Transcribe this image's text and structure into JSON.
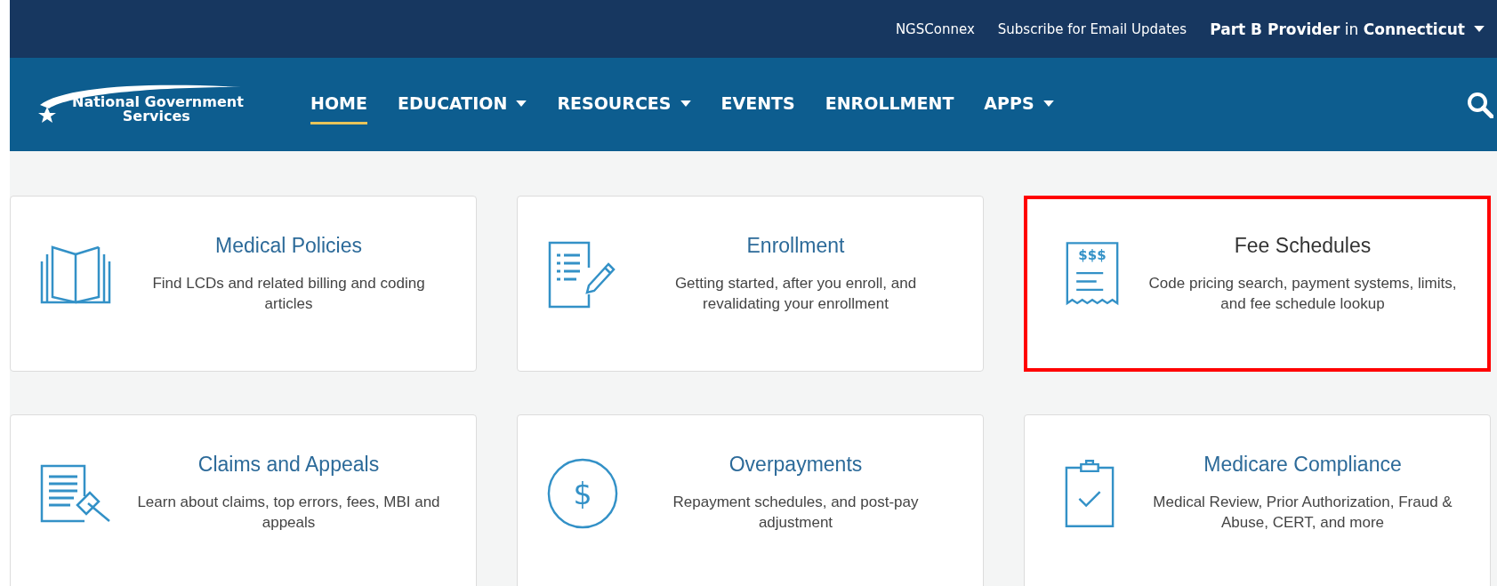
{
  "top_bar": {
    "links": [
      "NGSConnex",
      "Subscribe for Email Updates"
    ],
    "provider": {
      "role": "Part B Provider",
      "joiner": "in",
      "state": "Connecticut"
    }
  },
  "logo": {
    "line_1": "National Government",
    "line_2": "Services"
  },
  "nav": [
    {
      "label": "HOME",
      "selected": true,
      "dropdown": false
    },
    {
      "label": "EDUCATION",
      "selected": false,
      "dropdown": true
    },
    {
      "label": "RESOURCES",
      "selected": false,
      "dropdown": true
    },
    {
      "label": "EVENTS",
      "selected": false,
      "dropdown": false
    },
    {
      "label": "ENROLLMENT",
      "selected": false,
      "dropdown": false
    },
    {
      "label": "APPS",
      "selected": false,
      "dropdown": true
    }
  ],
  "cards": [
    {
      "kind": "book",
      "title": "Medical Policies",
      "description": "Find LCDs and related billing and coding articles",
      "highlighted": false
    },
    {
      "kind": "form",
      "title": "Enrollment",
      "description": "Getting started, after you enroll, and revalidating your enrollment",
      "highlighted": false
    },
    {
      "kind": "receipt",
      "icon_text": "$$$",
      "title": "Fee Schedules",
      "description": "Code pricing search, payment systems, limits, and fee schedule lookup",
      "highlighted": true
    },
    {
      "kind": "gavel",
      "title": "Claims and Appeals",
      "description": "Learn about claims, top errors, fees, MBI and appeals",
      "highlighted": false
    },
    {
      "kind": "dollar",
      "icon_text": "$",
      "title": "Overpayments",
      "description": "Repayment schedules, and post-pay adjustment",
      "highlighted": false
    },
    {
      "kind": "clipboard",
      "title": "Medicare Compliance",
      "description": "Medical Review, Prior Authorization, Fraud & Abuse, CERT, and more",
      "highlighted": false
    }
  ]
}
